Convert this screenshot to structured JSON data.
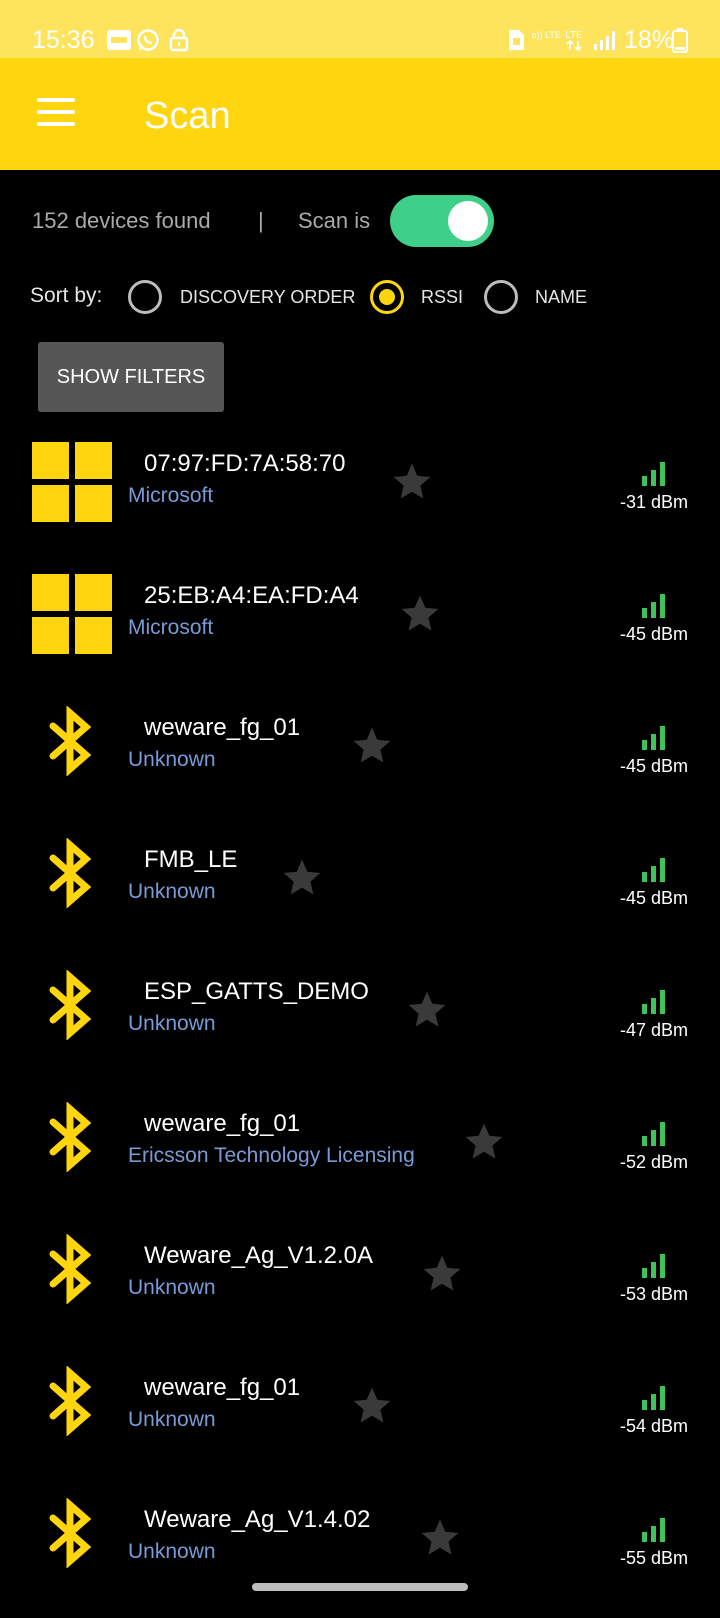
{
  "status_bar": {
    "time": "15:36",
    "battery": "18%",
    "icons": [
      "notification-icon",
      "whatsapp-icon",
      "lock-icon",
      "sim-icon",
      "volte-icon",
      "lte-icon",
      "signal-icon",
      "battery-icon"
    ],
    "volte_label": "Vo)) LTE1",
    "lte_label": "LTE"
  },
  "app_bar": {
    "title": "Scan",
    "menu_icon": "hamburger-menu-icon",
    "color": "#fed50f"
  },
  "summary": {
    "devices_found": "152 devices found",
    "separator": "|",
    "scan_label": "Scan is",
    "scan_on": true,
    "toggle_color": "#3ed088"
  },
  "sort": {
    "label": "Sort by:",
    "options": [
      {
        "label": "DISCOVERY ORDER",
        "selected": false
      },
      {
        "label": "RSSI",
        "selected": true
      },
      {
        "label": "NAME",
        "selected": false
      }
    ]
  },
  "filters_button": "SHOW FILTERS",
  "devices": [
    {
      "icon": "windows-logo-icon",
      "name": "07:97:FD:7A:58:70",
      "vendor": "Microsoft",
      "rssi": "-31 dBm"
    },
    {
      "icon": "windows-logo-icon",
      "name": "25:EB:A4:EA:FD:A4",
      "vendor": "Microsoft",
      "rssi": "-45 dBm"
    },
    {
      "icon": "bluetooth-icon",
      "name": "weware_fg_01",
      "vendor": "Unknown",
      "rssi": "-45 dBm"
    },
    {
      "icon": "bluetooth-icon",
      "name": "FMB_LE",
      "vendor": "Unknown",
      "rssi": "-45 dBm"
    },
    {
      "icon": "bluetooth-icon",
      "name": "ESP_GATTS_DEMO",
      "vendor": "Unknown",
      "rssi": "-47 dBm"
    },
    {
      "icon": "bluetooth-icon",
      "name": "weware_fg_01",
      "vendor": "Ericsson Technology Licensing",
      "rssi": "-52 dBm"
    },
    {
      "icon": "bluetooth-icon",
      "name": "Weware_Ag_V1.2.0A",
      "vendor": "Unknown",
      "rssi": "-53 dBm"
    },
    {
      "icon": "bluetooth-icon",
      "name": "weware_fg_01",
      "vendor": "Unknown",
      "rssi": "-54 dBm"
    },
    {
      "icon": "bluetooth-icon",
      "name": "Weware_Ag_V1.4.02",
      "vendor": "Unknown",
      "rssi": "-55 dBm"
    }
  ],
  "colors": {
    "background": "#000000",
    "accent": "#fed50f",
    "vendor_text": "#7a9ad6",
    "signal": "#3ec35a",
    "favorite_star": "#3a3a3a"
  }
}
